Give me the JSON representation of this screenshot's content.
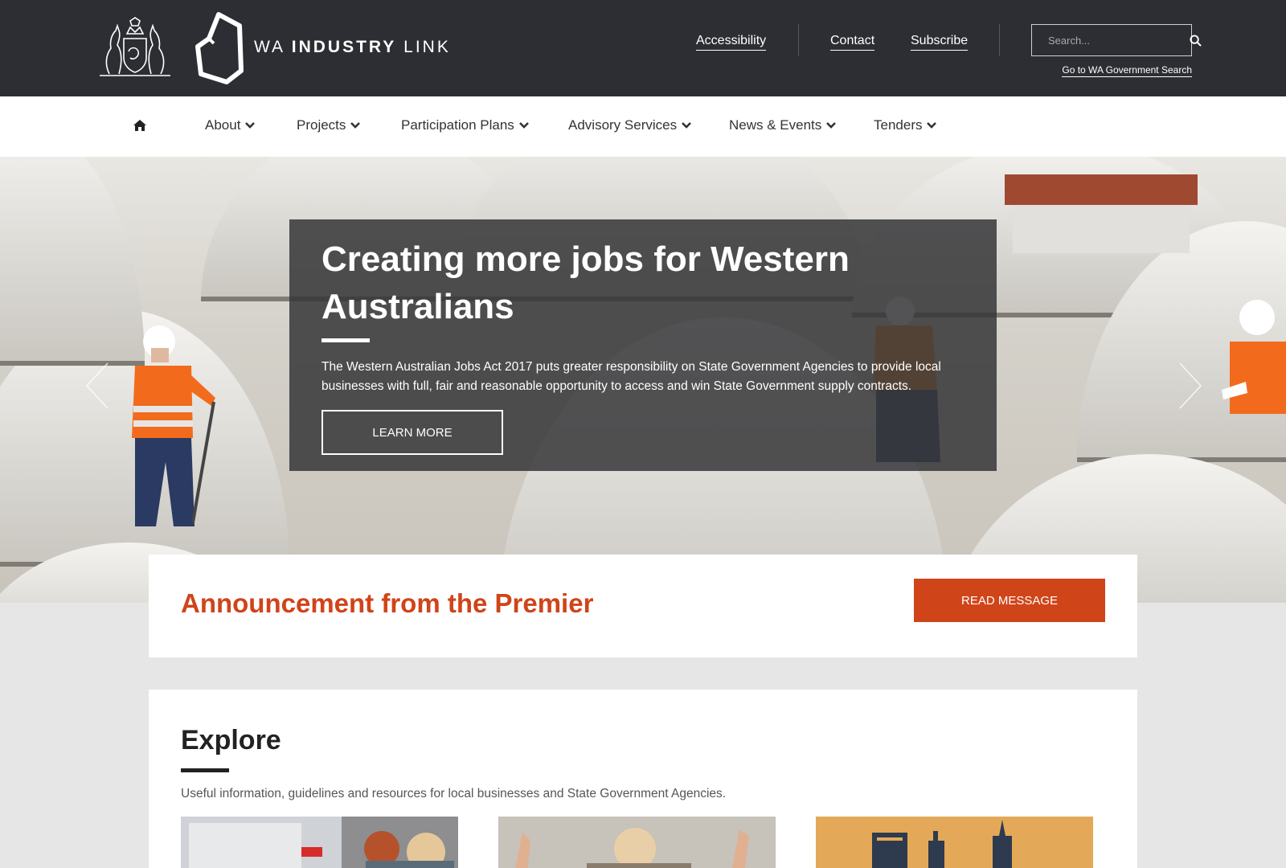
{
  "header": {
    "brand_prefix": "WA",
    "brand_main": "INDUSTRY",
    "brand_suffix": "LINK",
    "links": {
      "accessibility": "Accessibility",
      "contact": "Contact",
      "subscribe": "Subscribe"
    },
    "search": {
      "placeholder": "Search..."
    },
    "gov_search": "Go to WA Government Search"
  },
  "nav": {
    "home_icon": "home-icon",
    "items": [
      {
        "label": "About"
      },
      {
        "label": "Projects"
      },
      {
        "label": "Participation Plans"
      },
      {
        "label": "Advisory Services"
      },
      {
        "label": "News & Events"
      },
      {
        "label": "Tenders"
      }
    ]
  },
  "hero": {
    "title": "Creating more jobs for Western Australians",
    "text": "The Western Australian Jobs Act 2017 puts greater responsibility on State Government Agencies to provide local businesses with full, fair and reasonable opportunity to access and win State Government supply contracts.",
    "button": "LEARN MORE"
  },
  "announcement": {
    "title": "Announcement from the Premier",
    "button": "READ MESSAGE"
  },
  "explore": {
    "title": "Explore",
    "text": "Useful information, guidelines and resources for local businesses and State Government Agencies."
  },
  "colors": {
    "header_bg": "#2d2e33",
    "accent": "#d04419",
    "page_bg": "#e6e6e6"
  }
}
